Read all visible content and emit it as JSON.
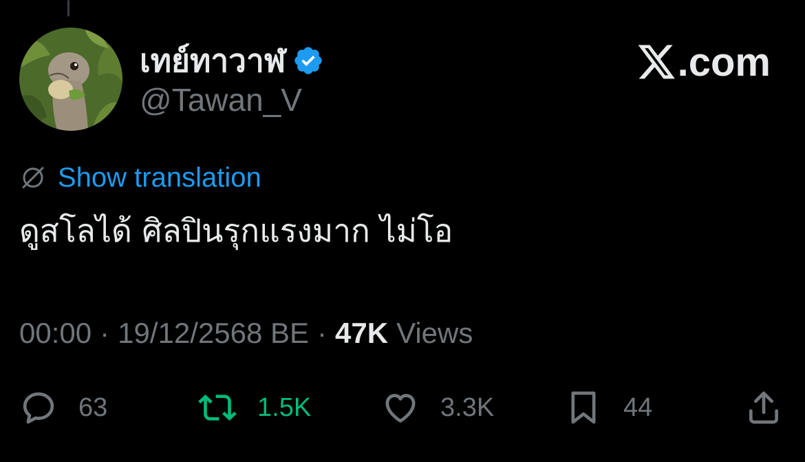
{
  "author": {
    "display_name": "เทย์ทาวาฬ",
    "handle": "@Tawan_V",
    "verified": true
  },
  "brand": {
    "x_icon": "x-logo-icon",
    "suffix": ".com"
  },
  "translation": {
    "link_label": "Show translation"
  },
  "tweet": {
    "text": "ดูสโลได้ ศิลปินรุกแรงมาก ไม่โอ"
  },
  "meta": {
    "time": "00:00",
    "separator": "·",
    "date": "19/12/2568 BE",
    "views_count": "47K",
    "views_label": "Views"
  },
  "actions": {
    "reply_count": "63",
    "retweet_count": "1.5K",
    "like_count": "3.3K",
    "bookmark_count": "44"
  },
  "colors": {
    "background": "#000000",
    "text_primary": "#e7e9ea",
    "text_secondary": "#71767b",
    "link": "#1d9bf0",
    "retweet_active": "#00ba7c",
    "verified_badge": "#1d9bf0"
  }
}
